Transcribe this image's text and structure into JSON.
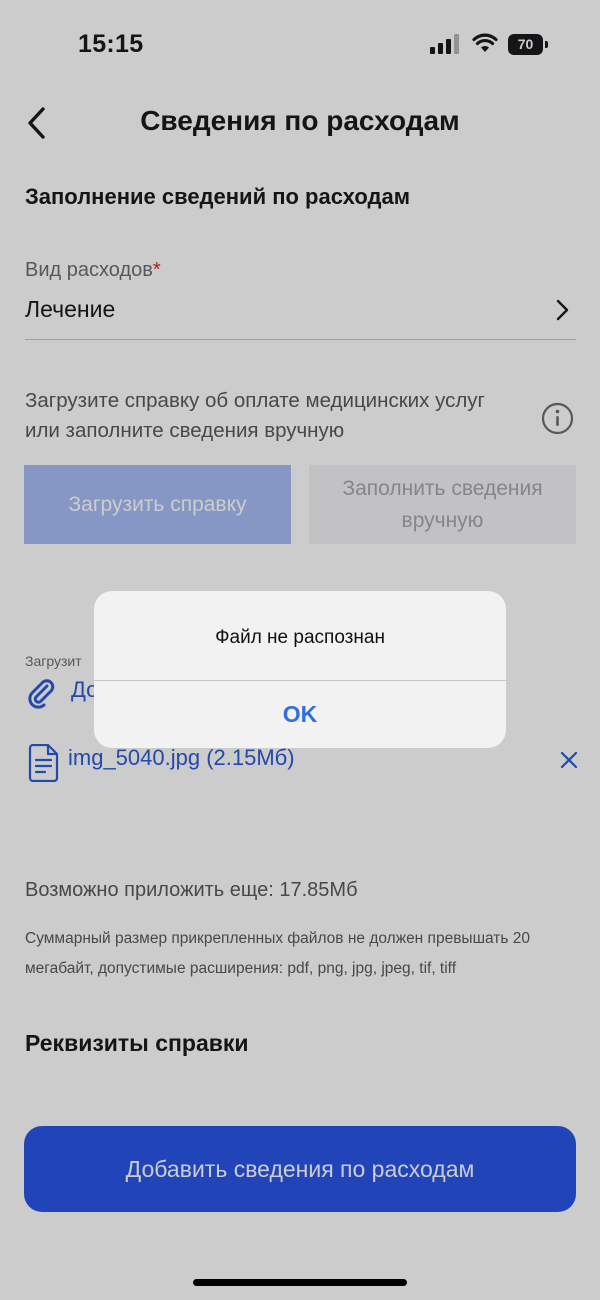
{
  "status_bar": {
    "time": "15:15",
    "battery": "70"
  },
  "header": {
    "title": "Сведения по расходам"
  },
  "form": {
    "section_title": "Заполнение сведений по расходам",
    "expense_type_label": "Вид расходов",
    "required_mark": "*",
    "expense_type_value": "Лечение",
    "upload_hint": "Загрузите справку об оплате медицинских услуг или заполните сведения вручную",
    "upload_button": "Загрузить справку",
    "manual_button": "Заполнить сведения вручную",
    "upload_small_label": "Загрузит",
    "add_document_text": "До",
    "attached_file": "img_5040.jpg (2.15Мб)",
    "remaining_size": "Возможно приложить еще: 17.85Мб",
    "size_note": "Суммарный размер прикрепленных файлов не должен превышать 20 мегабайт, допустимые расширения: pdf, png, jpg, jpeg, tif, tiff",
    "requisites_title": "Реквизиты справки",
    "submit_button": "Добавить сведения по расходам"
  },
  "alert": {
    "message": "Файл не распознан",
    "ok": "OK"
  },
  "colors": {
    "accent": "#2a57e6",
    "link": "#2c5cd9",
    "required": "#d12a2a"
  }
}
